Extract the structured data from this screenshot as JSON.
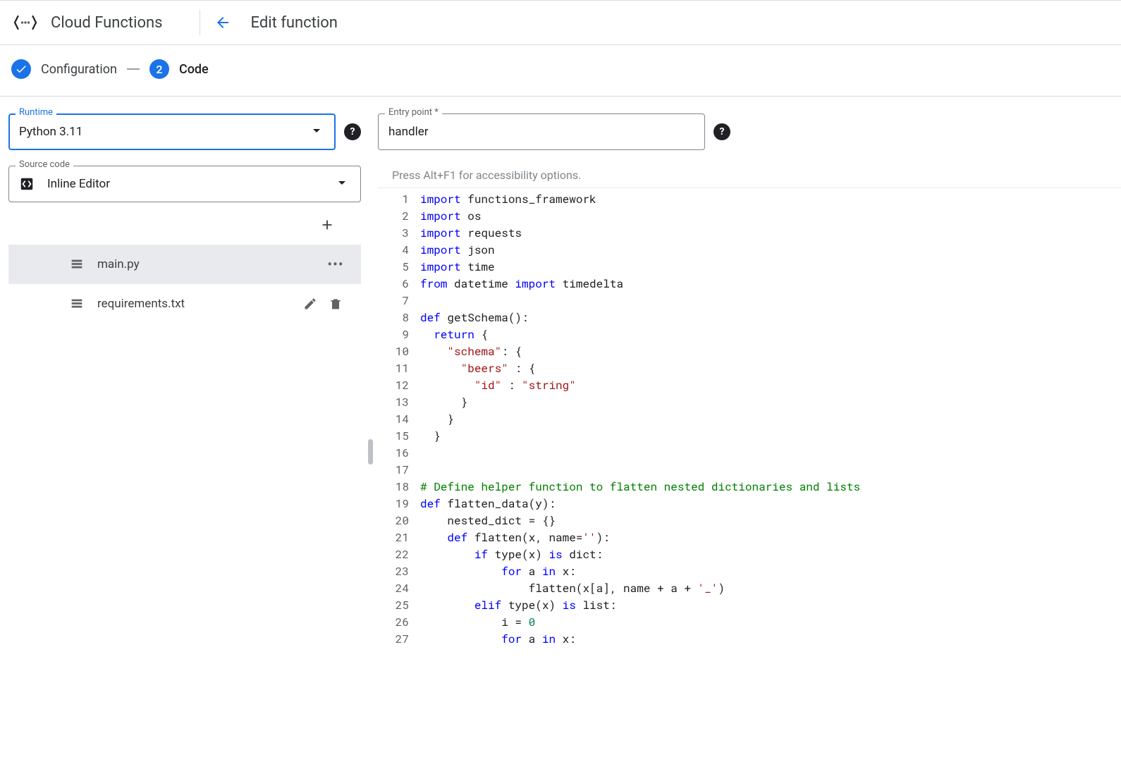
{
  "header": {
    "product": "Cloud Functions",
    "action": "Edit function"
  },
  "stepper": {
    "step1_label": "Configuration",
    "step2_num": "2",
    "step2_label": "Code"
  },
  "form": {
    "runtime_label": "Runtime",
    "runtime_value": "Python 3.11",
    "entry_label": "Entry point *",
    "entry_value": "handler",
    "source_label": "Source code",
    "source_value": "Inline Editor"
  },
  "files": [
    {
      "name": "main.py",
      "selected": true
    },
    {
      "name": "requirements.txt",
      "selected": false
    }
  ],
  "editor": {
    "hint": "Press Alt+F1 for accessibility options.",
    "lines": [
      [
        [
          "kw",
          "import"
        ],
        [
          "",
          " functions_framework"
        ]
      ],
      [
        [
          "kw",
          "import"
        ],
        [
          "",
          " os"
        ]
      ],
      [
        [
          "kw",
          "import"
        ],
        [
          "",
          " requests"
        ]
      ],
      [
        [
          "kw",
          "import"
        ],
        [
          "",
          " json"
        ]
      ],
      [
        [
          "kw",
          "import"
        ],
        [
          "",
          " time"
        ]
      ],
      [
        [
          "kw",
          "from"
        ],
        [
          "",
          " datetime "
        ],
        [
          "kw",
          "import"
        ],
        [
          "",
          " timedelta"
        ]
      ],
      [
        [
          "",
          ""
        ]
      ],
      [
        [
          "kw",
          "def"
        ],
        [
          "",
          " getSchema():"
        ]
      ],
      [
        [
          "",
          "  "
        ],
        [
          "kw",
          "return"
        ],
        [
          "",
          " {"
        ]
      ],
      [
        [
          "",
          "    "
        ],
        [
          "str",
          "\"schema\""
        ],
        [
          "",
          ": {"
        ]
      ],
      [
        [
          "",
          "      "
        ],
        [
          "str",
          "\"beers\""
        ],
        [
          "",
          " : {"
        ]
      ],
      [
        [
          "",
          "        "
        ],
        [
          "str",
          "\"id\""
        ],
        [
          "",
          " : "
        ],
        [
          "str",
          "\"string\""
        ]
      ],
      [
        [
          "",
          "      }"
        ]
      ],
      [
        [
          "",
          "    }"
        ]
      ],
      [
        [
          "",
          "  }"
        ]
      ],
      [
        [
          "",
          ""
        ]
      ],
      [
        [
          "",
          ""
        ]
      ],
      [
        [
          "com",
          "# Define helper function to flatten nested dictionaries and lists"
        ]
      ],
      [
        [
          "kw",
          "def"
        ],
        [
          "",
          " flatten_data(y):"
        ]
      ],
      [
        [
          "",
          "    nested_dict = {}"
        ]
      ],
      [
        [
          "",
          "    "
        ],
        [
          "kw",
          "def"
        ],
        [
          "",
          " flatten(x, name="
        ],
        [
          "str",
          "''"
        ],
        [
          "",
          "):"
        ]
      ],
      [
        [
          "",
          "        "
        ],
        [
          "kw",
          "if"
        ],
        [
          "",
          " type(x) "
        ],
        [
          "kw",
          "is"
        ],
        [
          "",
          " dict:"
        ]
      ],
      [
        [
          "",
          "            "
        ],
        [
          "kw",
          "for"
        ],
        [
          "",
          " a "
        ],
        [
          "kw",
          "in"
        ],
        [
          "",
          " x:"
        ]
      ],
      [
        [
          "",
          "                flatten(x[a], name + a + "
        ],
        [
          "str",
          "'_'"
        ],
        [
          "",
          ")"
        ]
      ],
      [
        [
          "",
          "        "
        ],
        [
          "kw",
          "elif"
        ],
        [
          "",
          " type(x) "
        ],
        [
          "kw",
          "is"
        ],
        [
          "",
          " list:"
        ]
      ],
      [
        [
          "",
          "            i = "
        ],
        [
          "num",
          "0"
        ]
      ],
      [
        [
          "",
          "            "
        ],
        [
          "kw",
          "for"
        ],
        [
          "",
          " a "
        ],
        [
          "kw",
          "in"
        ],
        [
          "",
          " x:"
        ]
      ]
    ]
  }
}
